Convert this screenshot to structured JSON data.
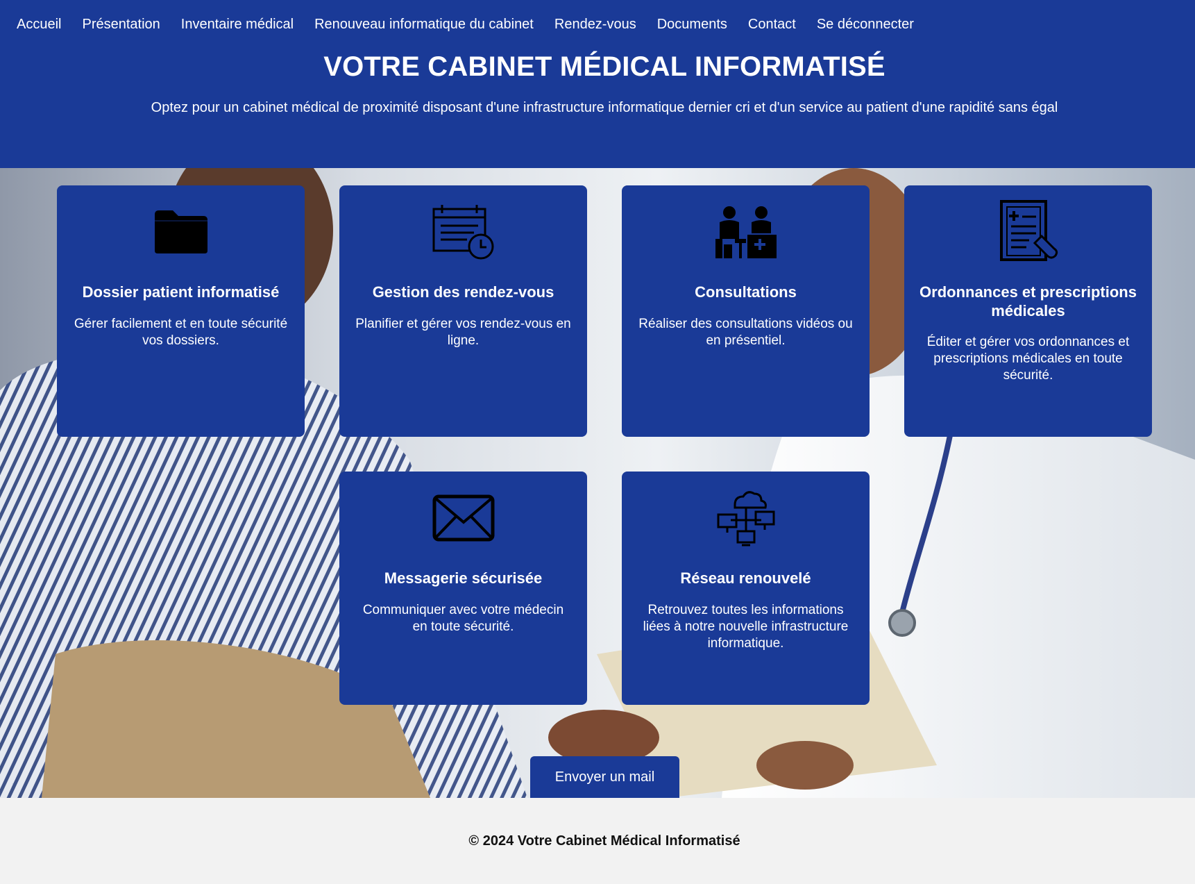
{
  "nav": {
    "items": [
      {
        "label": "Accueil"
      },
      {
        "label": "Présentation"
      },
      {
        "label": "Inventaire médical"
      },
      {
        "label": "Renouveau informatique du cabinet"
      },
      {
        "label": "Rendez-vous"
      },
      {
        "label": "Documents"
      },
      {
        "label": "Contact"
      },
      {
        "label": "Se déconnecter"
      }
    ]
  },
  "header": {
    "title": "VOTRE CABINET MÉDICAL INFORMATISÉ",
    "subtitle": "Optez pour un cabinet médical de proximité disposant d'une infrastructure informatique dernier cri et d'un service au patient d'une rapidité sans égal"
  },
  "cards": [
    {
      "icon": "folder-icon",
      "title": "Dossier patient informatisé",
      "text": "Gérer facilement et en toute sécurité vos dossiers."
    },
    {
      "icon": "calendar-clock-icon",
      "title": "Gestion des rendez-vous",
      "text": "Planifier et gérer vos rendez-vous en ligne."
    },
    {
      "icon": "consultation-icon",
      "title": "Consultations",
      "text": "Réaliser des consultations vidéos ou en présentiel."
    },
    {
      "icon": "prescription-icon",
      "title": "Ordonnances et prescriptions médicales",
      "text": "Éditer et gérer vos ordonnances et prescriptions médicales en toute sécurité."
    },
    {
      "icon": "envelope-icon",
      "title": "Messagerie sécurisée",
      "text": "Communiquer avec votre médecin en toute sécurité."
    },
    {
      "icon": "cloud-network-icon",
      "title": "Réseau renouvelé",
      "text": "Retrouvez toutes les informations liées à notre nouvelle infrastructure informatique."
    }
  ],
  "cta": {
    "label": "Envoyer un mail"
  },
  "footer": {
    "text": "© 2024 Votre Cabinet Médical Informatisé"
  },
  "colors": {
    "primary": "#1a3a97",
    "footer_bg": "#f2f2f2"
  }
}
